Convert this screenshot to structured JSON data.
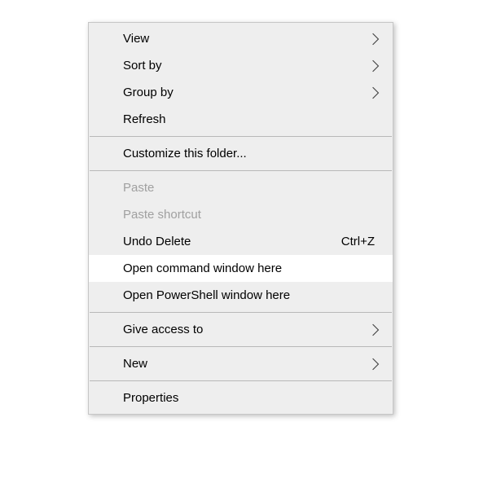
{
  "menu": {
    "items": [
      {
        "label": "View",
        "has_submenu": true
      },
      {
        "label": "Sort by",
        "has_submenu": true
      },
      {
        "label": "Group by",
        "has_submenu": true
      },
      {
        "label": "Refresh"
      },
      {
        "separator": true
      },
      {
        "label": "Customize this folder..."
      },
      {
        "separator": true
      },
      {
        "label": "Paste",
        "disabled": true
      },
      {
        "label": "Paste shortcut",
        "disabled": true
      },
      {
        "label": "Undo Delete",
        "shortcut": "Ctrl+Z"
      },
      {
        "label": "Open command window here",
        "highlighted": true
      },
      {
        "label": "Open PowerShell window here"
      },
      {
        "separator": true
      },
      {
        "label": "Give access to",
        "has_submenu": true
      },
      {
        "separator": true
      },
      {
        "label": "New",
        "has_submenu": true
      },
      {
        "separator": true
      },
      {
        "label": "Properties"
      }
    ]
  }
}
